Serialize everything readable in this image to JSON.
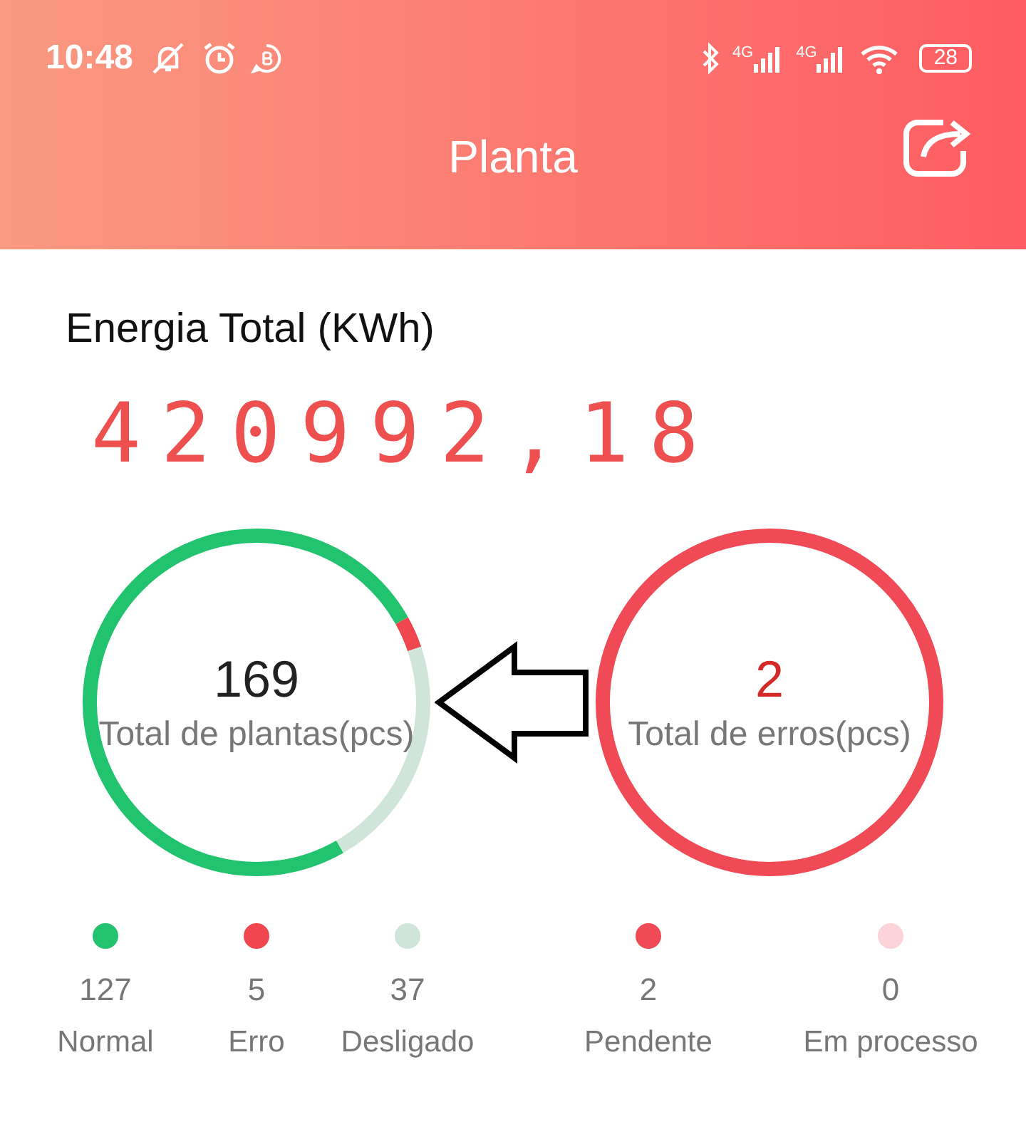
{
  "status_bar": {
    "time": "10:48",
    "network_labels": [
      "4G",
      "4G"
    ],
    "battery": "28"
  },
  "header": {
    "title": "Planta"
  },
  "energy": {
    "label": "Energia Total (KWh)",
    "value": "420992,18"
  },
  "gauges": [
    {
      "value": "169",
      "label": "Total de plantas(pcs)",
      "alert": false,
      "legend": [
        {
          "color": "#22c36e",
          "count": "127",
          "label": "Normal"
        },
        {
          "color": "#f0464f",
          "count": "5",
          "label": "Erro"
        },
        {
          "color": "#cfe5da",
          "count": "37",
          "label": "Desligado"
        }
      ]
    },
    {
      "value": "2",
      "label": "Total de erros(pcs)",
      "alert": true,
      "legend": [
        {
          "color": "#f04a56",
          "count": "2",
          "label": "Pendente"
        },
        {
          "color": "#fbd3d9",
          "count": "0",
          "label": "Em processo"
        }
      ]
    }
  ]
}
